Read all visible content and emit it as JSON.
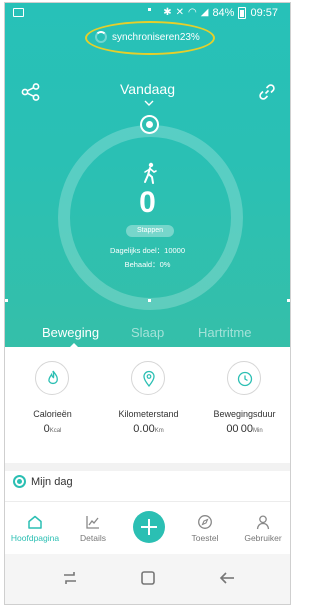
{
  "status_bar": {
    "battery": "84%",
    "time": "09:57"
  },
  "sync": {
    "text": "synchroniseren23%"
  },
  "header": {
    "title": "Vandaag"
  },
  "steps": {
    "count": "0",
    "unit_label": "Stappen",
    "daily_goal": "Dagelijks doel：10000",
    "achieved": "Behaald：0%"
  },
  "tabs": [
    {
      "label": "Beweging"
    },
    {
      "label": "Slaap"
    },
    {
      "label": "Hartritme"
    }
  ],
  "metrics": [
    {
      "label": "Calorieën",
      "value": "0",
      "unit": "Kcal",
      "icon": "flame-icon"
    },
    {
      "label": "Kilometerstand",
      "value": "0.00",
      "unit": "Km",
      "icon": "location-pin-icon"
    },
    {
      "label": "Bewegingsduur",
      "value": "00 00",
      "unit": "Min",
      "icon": "clock-icon"
    }
  ],
  "section": {
    "title": "Mijn dag"
  },
  "bottom_nav": [
    {
      "label": "Hoofdpagina",
      "icon": "home-icon"
    },
    {
      "label": "Details",
      "icon": "chart-icon"
    },
    {
      "label": "",
      "icon": "plus-icon"
    },
    {
      "label": "Toestel",
      "icon": "compass-icon"
    },
    {
      "label": "Gebruiker",
      "icon": "user-icon"
    }
  ],
  "colors": {
    "accent": "#2bbfb3",
    "highlight_oval": "#e6cf2a"
  }
}
